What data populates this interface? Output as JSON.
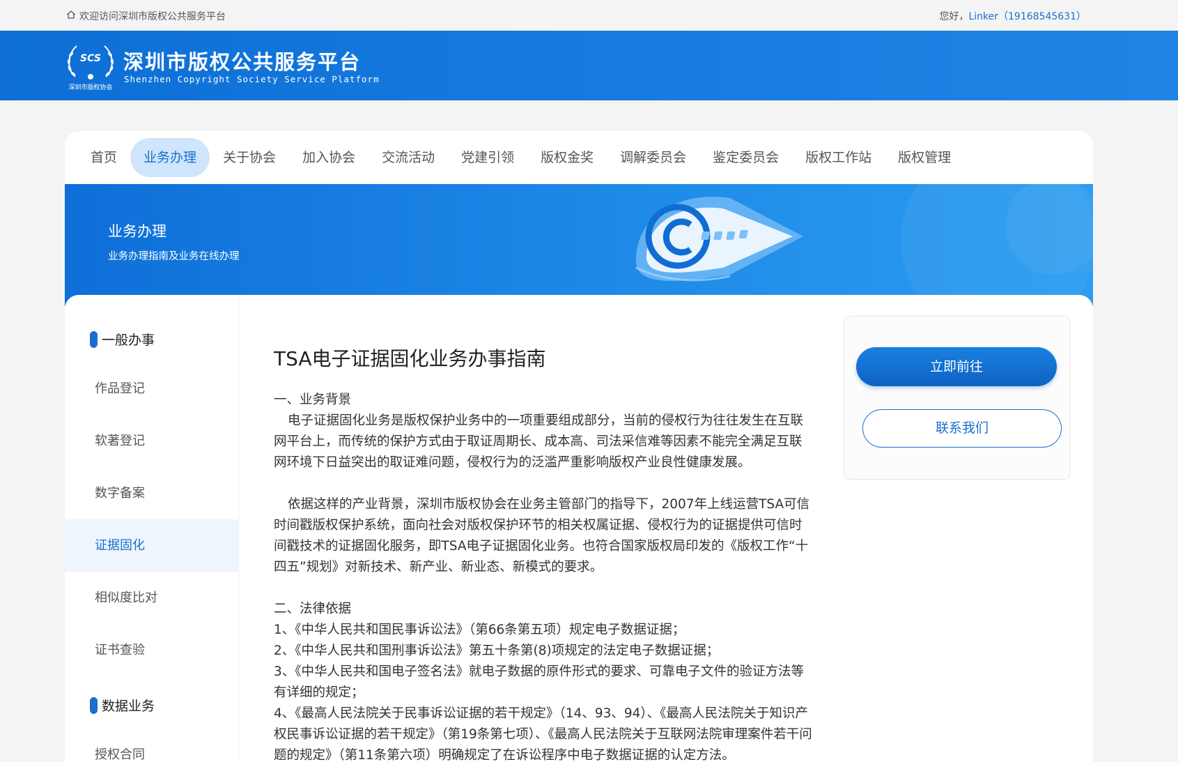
{
  "topbar": {
    "welcome": "欢迎访问深圳市版权公共服务平台",
    "greet_prefix": "您好，",
    "user": "Linker（19168545631）"
  },
  "header": {
    "logo_abbr": "SCS",
    "logo_caption": "深圳市版权协会",
    "title": "深圳市版权公共服务平台",
    "subtitle": "Shenzhen Copyright Society Service Platform"
  },
  "nav": {
    "items": [
      {
        "label": "首页"
      },
      {
        "label": "业务办理",
        "active": true
      },
      {
        "label": "关于协会"
      },
      {
        "label": "加入协会"
      },
      {
        "label": "交流活动"
      },
      {
        "label": "党建引领"
      },
      {
        "label": "版权金奖"
      },
      {
        "label": "调解委员会"
      },
      {
        "label": "鉴定委员会"
      },
      {
        "label": "版权工作站"
      },
      {
        "label": "版权管理"
      }
    ]
  },
  "banner": {
    "title": "业务办理",
    "subtitle": "业务办理指南及业务在线办理"
  },
  "sidebar": {
    "group1": "一般办事",
    "items": [
      {
        "label": "作品登记"
      },
      {
        "label": "软著登记"
      },
      {
        "label": "数字备案"
      },
      {
        "label": "证据固化",
        "active": true
      },
      {
        "label": "相似度比对"
      },
      {
        "label": "证书查验"
      }
    ],
    "group2": "数据业务",
    "items2": [
      {
        "label": "授权合同"
      }
    ]
  },
  "article": {
    "title": "TSA电子证据固化业务办事指南",
    "paragraphs": [
      "一、业务背景",
      "电子证据固化业务是版权保护业务中的一项重要组成部分，当前的侵权行为往往发生在互联网平台上，而传统的保护方式由于取证周期长、成本高、司法采信难等因素不能完全满足互联网环境下日益突出的取证难问题，侵权行为的泛滥严重影响版权产业良性健康发展。",
      "依据这样的产业背景，深圳市版权协会在业务主管部门的指导下，2007年上线运营TSA可信时间戳版权保护系统，面向社会对版权保护环节的相关权属证据、侵权行为的证据提供可信时间戳技术的证据固化服务，即TSA电子证据固化业务。也符合国家版权局印发的《版权工作“十四五”规划》对新技术、新产业、新业态、新模式的要求。",
      "二、法律依据",
      "1、《中华人民共和国民事诉讼法》（第66条第五项）规定电子数据证据；",
      "2、《中华人民共和国刑事诉讼法》第五十条第(8)项规定的法定电子数据证据；",
      "3、《中华人民共和国电子签名法》就电子数据的原件形式的要求、可靠电子文件的验证方法等有详细的规定；",
      "4、《最高人民法院关于民事诉讼证据的若干规定》（14、93、94）、《最高人民法院关于知识产权民事诉讼证据的若干规定》（第19条第七项）、《最高人民法院关于互联网法院审理案件若干问题的规定》（第11条第六项）明确规定了在诉讼程序中电子数据证据的认定方法。"
    ]
  },
  "aside": {
    "primary_label": "立即前往",
    "secondary_label": "联系我们"
  },
  "colors": {
    "brand": "#1a6fce",
    "header_bg": "#0d6fd6",
    "nav_active_bg": "#cfe5fb"
  }
}
